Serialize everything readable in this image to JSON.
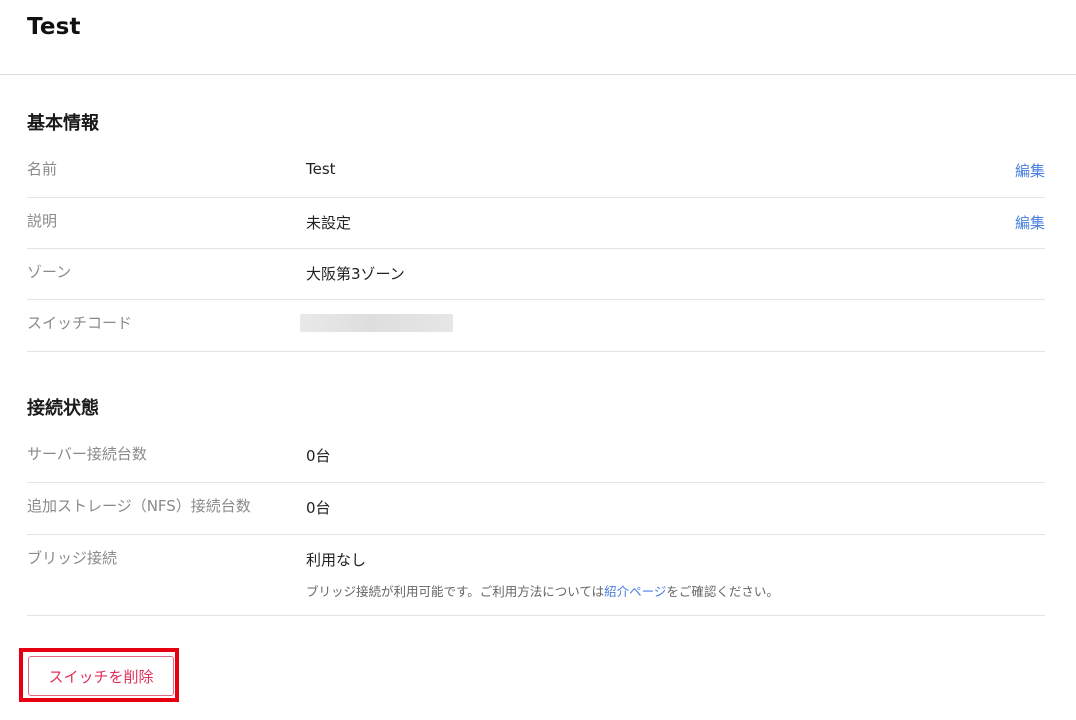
{
  "header": {
    "title": "Test"
  },
  "basic_info": {
    "heading": "基本情報",
    "rows": [
      {
        "label": "名前",
        "value": "Test",
        "action": "編集"
      },
      {
        "label": "説明",
        "value": "未設定",
        "action": "編集"
      },
      {
        "label": "ゾーン",
        "value": "大阪第3ゾーン"
      },
      {
        "label": "スイッチコード",
        "value_masked": true
      }
    ]
  },
  "connection": {
    "heading": "接続状態",
    "rows": [
      {
        "label": "サーバー接続台数",
        "value": "0台"
      },
      {
        "label": "追加ストレージ（NFS）接続台数",
        "value": "0台"
      },
      {
        "label": "ブリッジ接続",
        "value": "利用なし",
        "note_before": "ブリッジ接続が利用可能です。ご利用方法については",
        "note_link": "紹介ページ",
        "note_after": "をご確認ください。"
      }
    ]
  },
  "actions": {
    "delete_label": "スイッチを削除"
  },
  "colors": {
    "link": "#4a7fe0",
    "danger": "#e0305a",
    "highlight_frame": "#e60012"
  }
}
